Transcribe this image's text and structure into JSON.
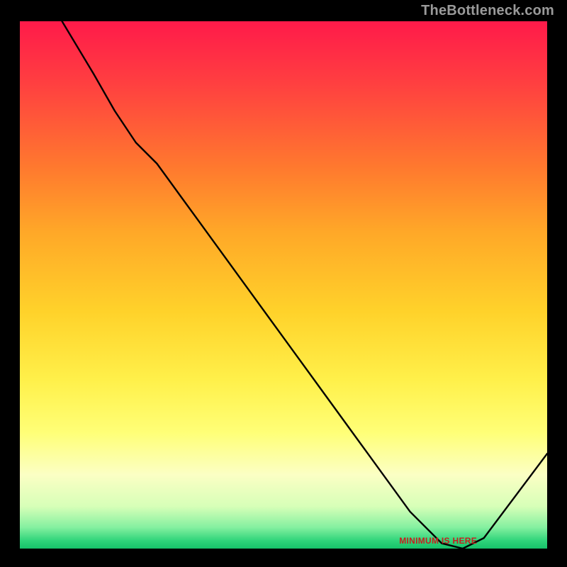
{
  "attribution": "TheBottleneck.com",
  "min_label": "MINIMUM IS HERE",
  "colors": {
    "curve_stroke": "#000000",
    "min_label_color": "#c81e1e"
  },
  "chart_data": {
    "type": "line",
    "title": "",
    "xlabel": "",
    "ylabel": "",
    "xlim": [
      0,
      100
    ],
    "ylim": [
      0,
      100
    ],
    "grid": false,
    "series": [
      {
        "name": "bottleneck-curve",
        "x": [
          8,
          14,
          18,
          22,
          26,
          34,
          42,
          50,
          58,
          66,
          74,
          80,
          84,
          88,
          100
        ],
        "values": [
          100,
          90,
          83,
          77,
          73,
          62,
          51,
          40,
          29,
          18,
          7,
          1,
          0,
          2,
          18
        ]
      }
    ],
    "annotations": [
      {
        "text_ref": "min_label",
        "x": 80,
        "y": 0.5
      }
    ]
  }
}
